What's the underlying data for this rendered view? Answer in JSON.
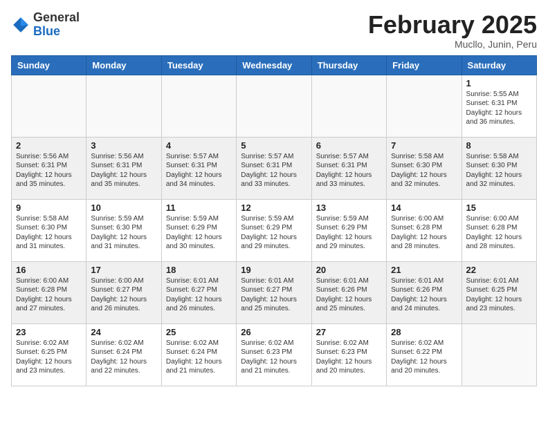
{
  "header": {
    "logo_general": "General",
    "logo_blue": "Blue",
    "month_title": "February 2025",
    "subtitle": "Mucllo, Junin, Peru"
  },
  "days_of_week": [
    "Sunday",
    "Monday",
    "Tuesday",
    "Wednesday",
    "Thursday",
    "Friday",
    "Saturday"
  ],
  "weeks": [
    {
      "shade": false,
      "days": [
        {
          "num": "",
          "info": ""
        },
        {
          "num": "",
          "info": ""
        },
        {
          "num": "",
          "info": ""
        },
        {
          "num": "",
          "info": ""
        },
        {
          "num": "",
          "info": ""
        },
        {
          "num": "",
          "info": ""
        },
        {
          "num": "1",
          "info": "Sunrise: 5:55 AM\nSunset: 6:31 PM\nDaylight: 12 hours\nand 36 minutes."
        }
      ]
    },
    {
      "shade": true,
      "days": [
        {
          "num": "2",
          "info": "Sunrise: 5:56 AM\nSunset: 6:31 PM\nDaylight: 12 hours\nand 35 minutes."
        },
        {
          "num": "3",
          "info": "Sunrise: 5:56 AM\nSunset: 6:31 PM\nDaylight: 12 hours\nand 35 minutes."
        },
        {
          "num": "4",
          "info": "Sunrise: 5:57 AM\nSunset: 6:31 PM\nDaylight: 12 hours\nand 34 minutes."
        },
        {
          "num": "5",
          "info": "Sunrise: 5:57 AM\nSunset: 6:31 PM\nDaylight: 12 hours\nand 33 minutes."
        },
        {
          "num": "6",
          "info": "Sunrise: 5:57 AM\nSunset: 6:31 PM\nDaylight: 12 hours\nand 33 minutes."
        },
        {
          "num": "7",
          "info": "Sunrise: 5:58 AM\nSunset: 6:30 PM\nDaylight: 12 hours\nand 32 minutes."
        },
        {
          "num": "8",
          "info": "Sunrise: 5:58 AM\nSunset: 6:30 PM\nDaylight: 12 hours\nand 32 minutes."
        }
      ]
    },
    {
      "shade": false,
      "days": [
        {
          "num": "9",
          "info": "Sunrise: 5:58 AM\nSunset: 6:30 PM\nDaylight: 12 hours\nand 31 minutes."
        },
        {
          "num": "10",
          "info": "Sunrise: 5:59 AM\nSunset: 6:30 PM\nDaylight: 12 hours\nand 31 minutes."
        },
        {
          "num": "11",
          "info": "Sunrise: 5:59 AM\nSunset: 6:29 PM\nDaylight: 12 hours\nand 30 minutes."
        },
        {
          "num": "12",
          "info": "Sunrise: 5:59 AM\nSunset: 6:29 PM\nDaylight: 12 hours\nand 29 minutes."
        },
        {
          "num": "13",
          "info": "Sunrise: 5:59 AM\nSunset: 6:29 PM\nDaylight: 12 hours\nand 29 minutes."
        },
        {
          "num": "14",
          "info": "Sunrise: 6:00 AM\nSunset: 6:28 PM\nDaylight: 12 hours\nand 28 minutes."
        },
        {
          "num": "15",
          "info": "Sunrise: 6:00 AM\nSunset: 6:28 PM\nDaylight: 12 hours\nand 28 minutes."
        }
      ]
    },
    {
      "shade": true,
      "days": [
        {
          "num": "16",
          "info": "Sunrise: 6:00 AM\nSunset: 6:28 PM\nDaylight: 12 hours\nand 27 minutes."
        },
        {
          "num": "17",
          "info": "Sunrise: 6:00 AM\nSunset: 6:27 PM\nDaylight: 12 hours\nand 26 minutes."
        },
        {
          "num": "18",
          "info": "Sunrise: 6:01 AM\nSunset: 6:27 PM\nDaylight: 12 hours\nand 26 minutes."
        },
        {
          "num": "19",
          "info": "Sunrise: 6:01 AM\nSunset: 6:27 PM\nDaylight: 12 hours\nand 25 minutes."
        },
        {
          "num": "20",
          "info": "Sunrise: 6:01 AM\nSunset: 6:26 PM\nDaylight: 12 hours\nand 25 minutes."
        },
        {
          "num": "21",
          "info": "Sunrise: 6:01 AM\nSunset: 6:26 PM\nDaylight: 12 hours\nand 24 minutes."
        },
        {
          "num": "22",
          "info": "Sunrise: 6:01 AM\nSunset: 6:25 PM\nDaylight: 12 hours\nand 23 minutes."
        }
      ]
    },
    {
      "shade": false,
      "days": [
        {
          "num": "23",
          "info": "Sunrise: 6:02 AM\nSunset: 6:25 PM\nDaylight: 12 hours\nand 23 minutes."
        },
        {
          "num": "24",
          "info": "Sunrise: 6:02 AM\nSunset: 6:24 PM\nDaylight: 12 hours\nand 22 minutes."
        },
        {
          "num": "25",
          "info": "Sunrise: 6:02 AM\nSunset: 6:24 PM\nDaylight: 12 hours\nand 21 minutes."
        },
        {
          "num": "26",
          "info": "Sunrise: 6:02 AM\nSunset: 6:23 PM\nDaylight: 12 hours\nand 21 minutes."
        },
        {
          "num": "27",
          "info": "Sunrise: 6:02 AM\nSunset: 6:23 PM\nDaylight: 12 hours\nand 20 minutes."
        },
        {
          "num": "28",
          "info": "Sunrise: 6:02 AM\nSunset: 6:22 PM\nDaylight: 12 hours\nand 20 minutes."
        },
        {
          "num": "",
          "info": ""
        }
      ]
    }
  ]
}
